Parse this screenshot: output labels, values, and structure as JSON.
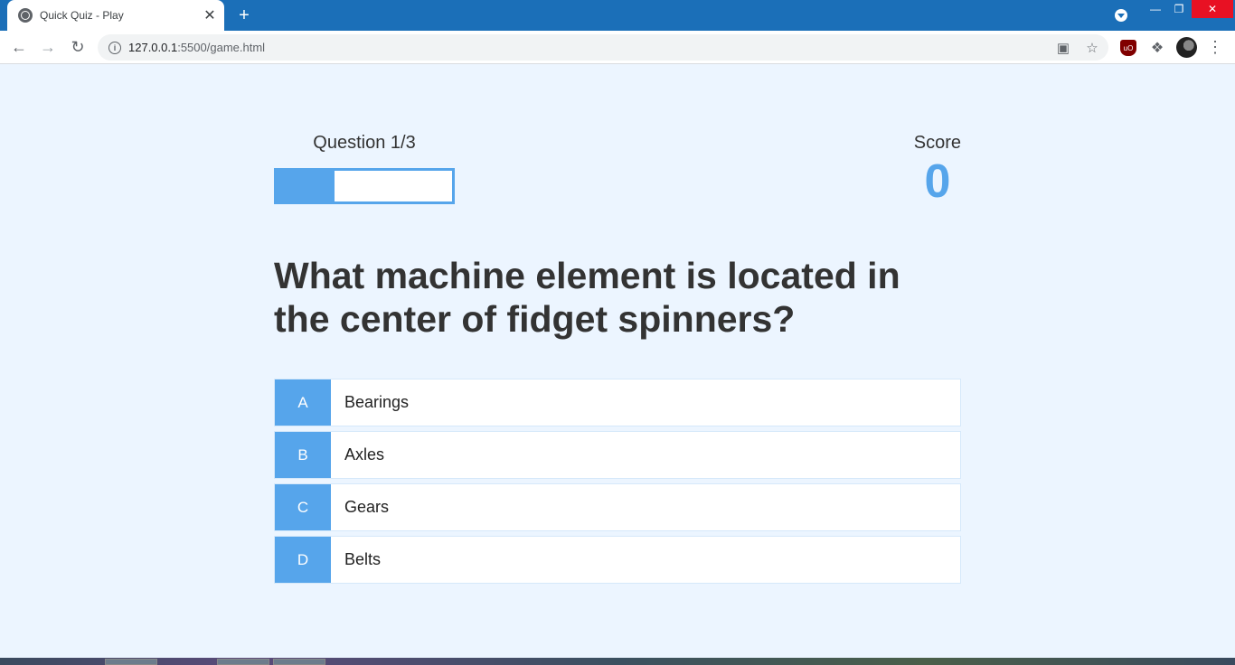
{
  "browser": {
    "tab_title": "Quick Quiz - Play",
    "tab_close_glyph": "✕",
    "new_tab_glyph": "+",
    "url_host": "127.0.0.1",
    "url_path": ":5500/game.html",
    "icons": {
      "tab_favicon": "globe-icon",
      "back": "arrow-left-icon",
      "forward": "arrow-right-icon",
      "reload": "reload-icon",
      "site_info": "info-icon",
      "translate": "translate-icon",
      "bookmark": "star-icon",
      "ublock": "ublock-icon",
      "extensions": "puzzle-icon",
      "profile": "avatar",
      "menu": "kebab-menu-icon"
    }
  },
  "hud": {
    "question_counter": "Question 1/3",
    "progress_fraction": 0.33,
    "score_label": "Score",
    "score_value": "0"
  },
  "question": "What machine element is located in the center of fidget spinners?",
  "choices": [
    {
      "prefix": "A",
      "text": "Bearings"
    },
    {
      "prefix": "B",
      "text": "Axles"
    },
    {
      "prefix": "C",
      "text": "Gears"
    },
    {
      "prefix": "D",
      "text": "Belts"
    }
  ],
  "colors": {
    "accent": "#56a5eb",
    "page_background": "#ecf5ff",
    "titlebar": "#1b6fb8",
    "text": "#333333"
  }
}
